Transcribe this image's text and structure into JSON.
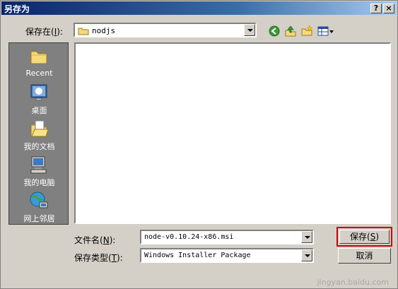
{
  "window": {
    "title": "另存为",
    "help_button": "?",
    "close_button": "×"
  },
  "save_in": {
    "label": "保存在",
    "hotkey": "I",
    "value": "nodjs"
  },
  "places": [
    {
      "label": "Recent",
      "icon": "recent-folder-icon"
    },
    {
      "label": "桌面",
      "icon": "desktop-icon"
    },
    {
      "label": "我的文档",
      "icon": "my-documents-icon"
    },
    {
      "label": "我的电脑",
      "icon": "my-computer-icon"
    },
    {
      "label": "网上邻居",
      "icon": "network-places-icon"
    }
  ],
  "filename": {
    "label": "文件名",
    "hotkey": "N",
    "value": "node-v0.10.24-x86.msi"
  },
  "filetype": {
    "label": "保存类型",
    "hotkey": "T",
    "value": "Windows Installer Package"
  },
  "buttons": {
    "save": "保存",
    "save_hotkey": "S",
    "cancel": "取消"
  },
  "toolbar": [
    "back-icon",
    "up-folder-icon",
    "new-folder-icon",
    "view-menu-icon"
  ],
  "watermark": "jingyan.baidu.com",
  "colors": {
    "titlebar_start": "#0a246a",
    "titlebar_end": "#a6caf0",
    "highlight_border": "#cc0000"
  }
}
